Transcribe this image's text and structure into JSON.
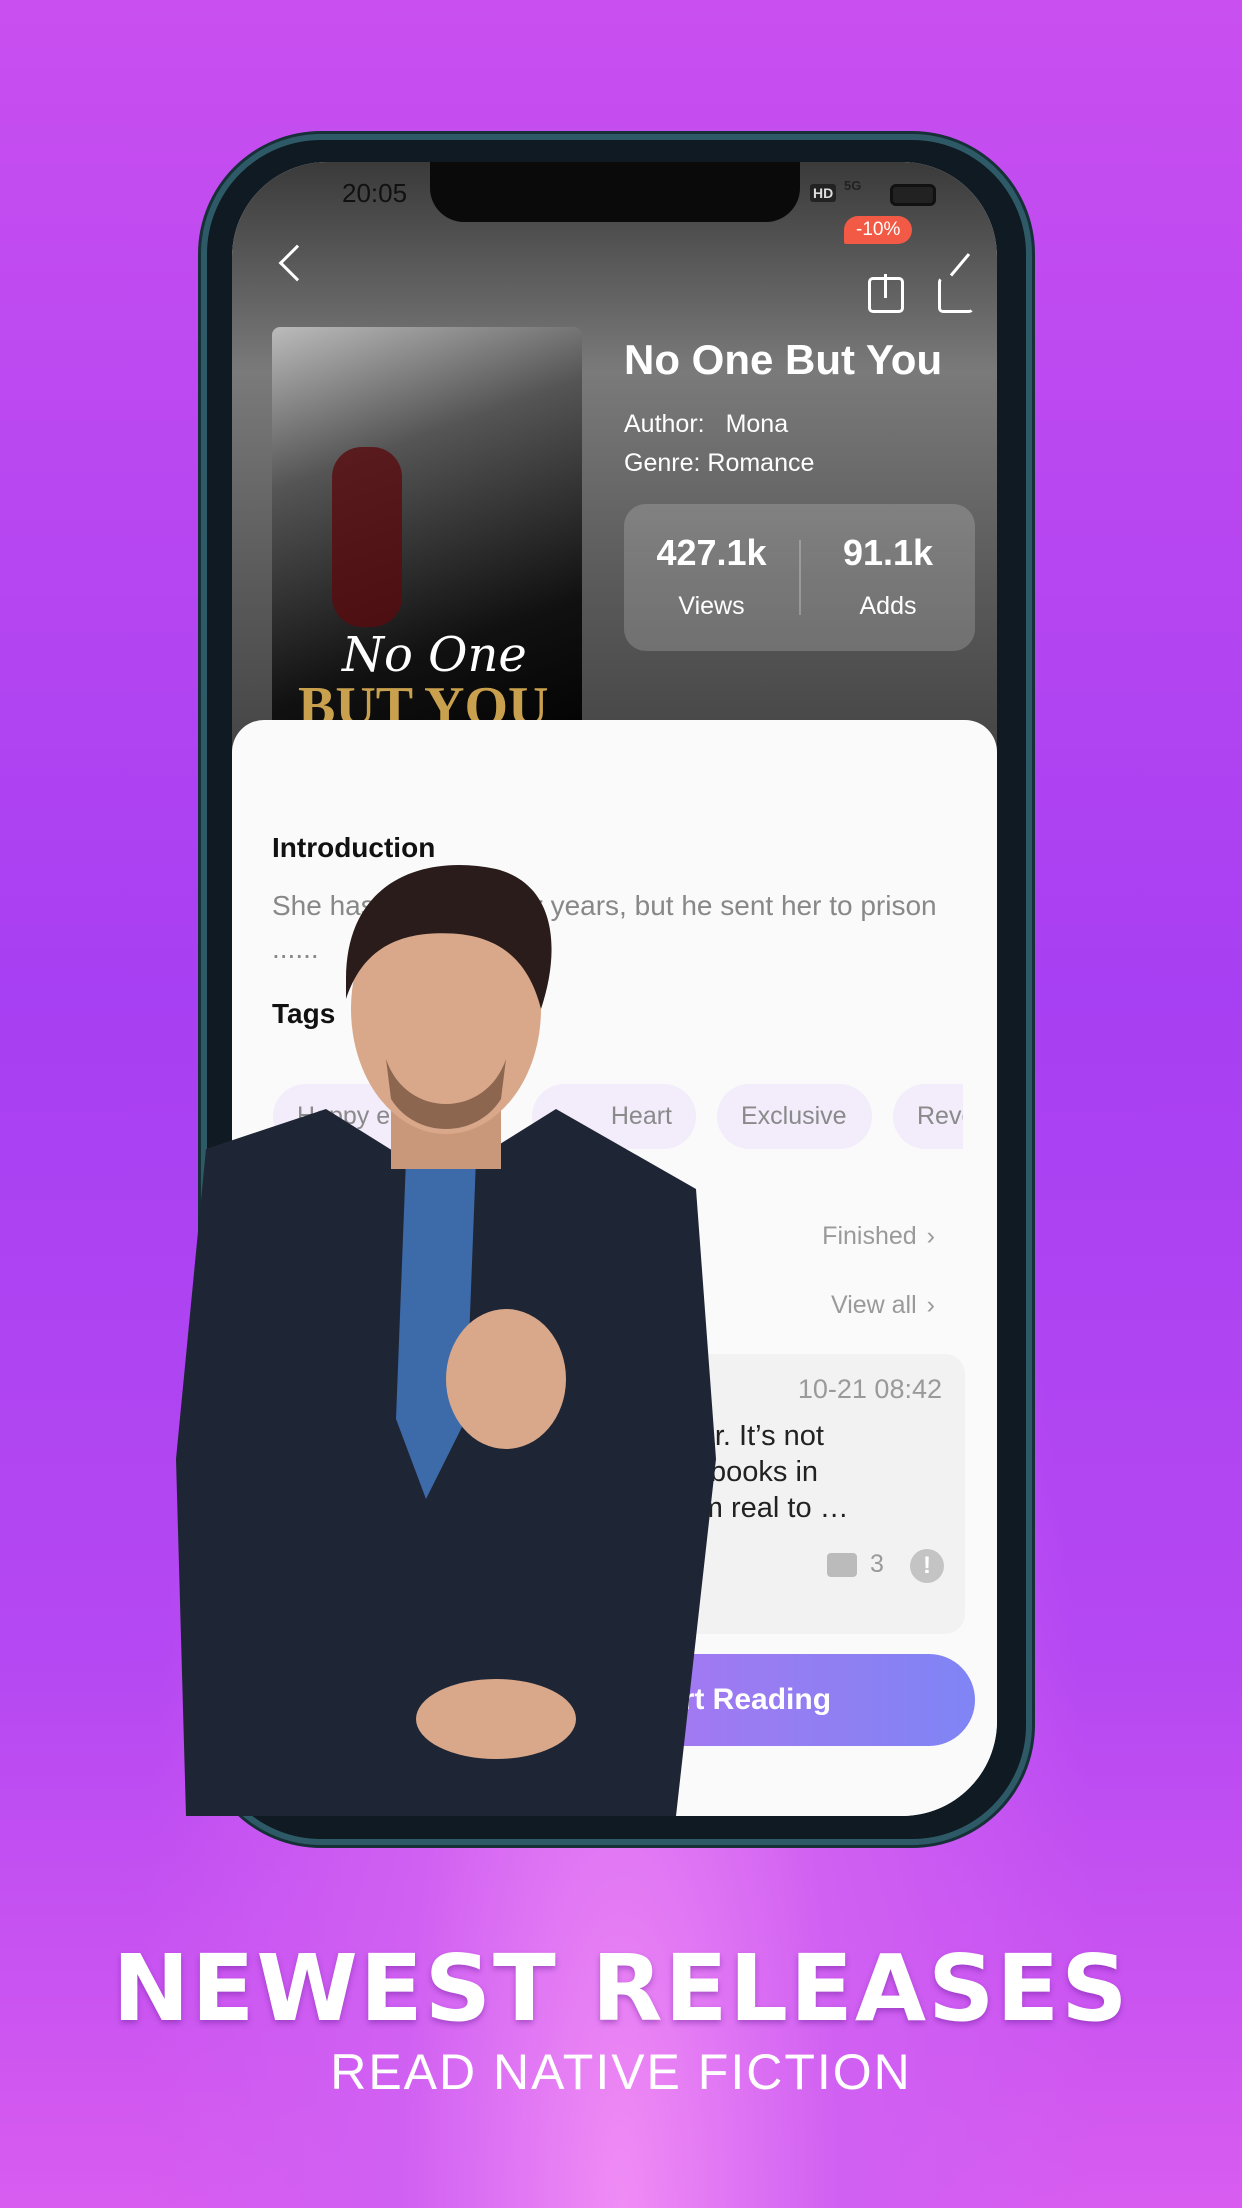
{
  "status_bar": {
    "time": "20:05",
    "network": "5G",
    "hd": "HD"
  },
  "header": {
    "discount_badge": "-10%"
  },
  "book": {
    "title": "No One But You",
    "cover_title_script": "No One",
    "cover_title": "BUT YOU",
    "author_label": "Author:",
    "author": "Mona",
    "genre_label": "Genre:",
    "genre": "Romance",
    "stats": [
      {
        "value": "427.1k",
        "label": "Views"
      },
      {
        "value": "91.1k",
        "label": "Adds"
      }
    ]
  },
  "introduction": {
    "heading": "Introduction",
    "text": "She has loved him for years, but he sent her to prison ......"
  },
  "tags": {
    "heading": "Tags",
    "items": [
      "Happy ending",
      "Heart",
      "Exclusive",
      "Reve"
    ]
  },
  "status_link": "Finished",
  "reviews": {
    "view_all": "View all",
    "date": "10-21 08:42",
    "text_lines": [
      "so far. It’s not",
      "or 3 books in",
      "seem real to …"
    ],
    "comment_count": "3"
  },
  "cta": {
    "start_reading": "Start Reading"
  },
  "promo": {
    "headline": "NEWEST RELEASES",
    "subline": "READ NATIVE FICTION"
  },
  "colors": {
    "accent_start": "#b46ef2",
    "accent_end": "#7f84f4",
    "badge": "#f25a45"
  }
}
